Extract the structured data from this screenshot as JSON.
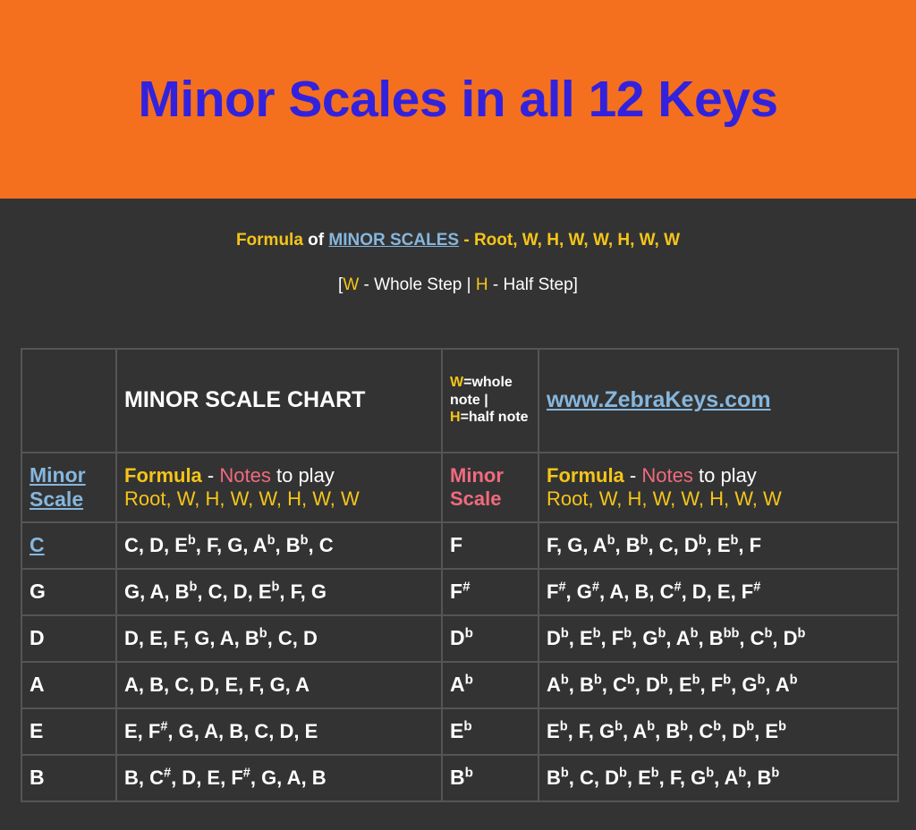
{
  "banner": {
    "title": "Minor Scales in all 12 Keys",
    "background_color": "#f4701f",
    "title_color": "#3322dd"
  },
  "formula": {
    "line1_word_formula": "Formula",
    "line1_word_of": "of",
    "line1_link": "MINOR SCALES",
    "line1_rest": "- Root, W, H, W, W, H, W, W",
    "line2_open": "[",
    "line2_w": "W",
    "line2_w_desc": "- Whole Step |",
    "line2_h": "H",
    "line2_h_desc": "- Half Step",
    "line2_close": "]"
  },
  "table": {
    "header": {
      "blank": "",
      "chart_title": "MINOR SCALE CHART",
      "legend": {
        "w": "W",
        "w_text": "=whole note |",
        "h": "H",
        "h_text": "=half note"
      },
      "website": "www.ZebraKeys.com"
    },
    "subheader": {
      "left_key_label": "Minor Scale",
      "left_formula_label": "Formula",
      "left_dash": "-",
      "left_notes_label": "Notes",
      "left_toplay": "to play",
      "left_formula_line2": "Root, W, H, W, W, H, W, W",
      "right_key_label": "Minor Scale",
      "right_formula_label": "Formula",
      "right_dash": "-",
      "right_notes_label": "Notes",
      "right_toplay": "to play",
      "right_formula_line2": "Root, W, H, W, W, H, W, W"
    },
    "rows": [
      {
        "left_key": "C",
        "left_key_is_link": true,
        "left_notes": "C, D, E♭, F, G, A♭, B♭, C",
        "right_key": "F",
        "right_notes": "F, G, A♭, B♭, C, D♭, E♭, F"
      },
      {
        "left_key": "G",
        "left_key_is_link": false,
        "left_notes": "G, A, B♭, C, D, E♭, F, G",
        "right_key": "F♯",
        "right_notes": "F♯, G♯, A, B, C♯, D, E, F♯"
      },
      {
        "left_key": "D",
        "left_key_is_link": false,
        "left_notes": "D, E, F, G, A, B♭, C, D",
        "right_key": "D♭",
        "right_notes": "D♭, E♭, F♭, G♭, A♭, B♭♭, C♭, D♭"
      },
      {
        "left_key": "A",
        "left_key_is_link": false,
        "left_notes": "A, B, C, D, E, F, G, A",
        "right_key": "A♭",
        "right_notes": "A♭, B♭, C♭, D♭, E♭, F♭, G♭, A♭"
      },
      {
        "left_key": "E",
        "left_key_is_link": false,
        "left_notes": "E, F♯, G, A, B, C, D, E",
        "right_key": "E♭",
        "right_notes": "E♭, F, G♭, A♭, B♭, C♭, D♭, E♭"
      },
      {
        "left_key": "B",
        "left_key_is_link": false,
        "left_notes": "B, C♯, D, E, F♯, G, A, B",
        "right_key": "B♭",
        "right_notes": "B♭, C, D♭, E♭, F, G♭, A♭, B♭"
      }
    ]
  },
  "colors": {
    "page_background": "#333333",
    "accent_yellow": "#f5c518",
    "note_pink": "#f06a7e",
    "link_blue": "#86b6dd",
    "banner_orange": "#f4701f",
    "title_blue": "#3322dd"
  }
}
